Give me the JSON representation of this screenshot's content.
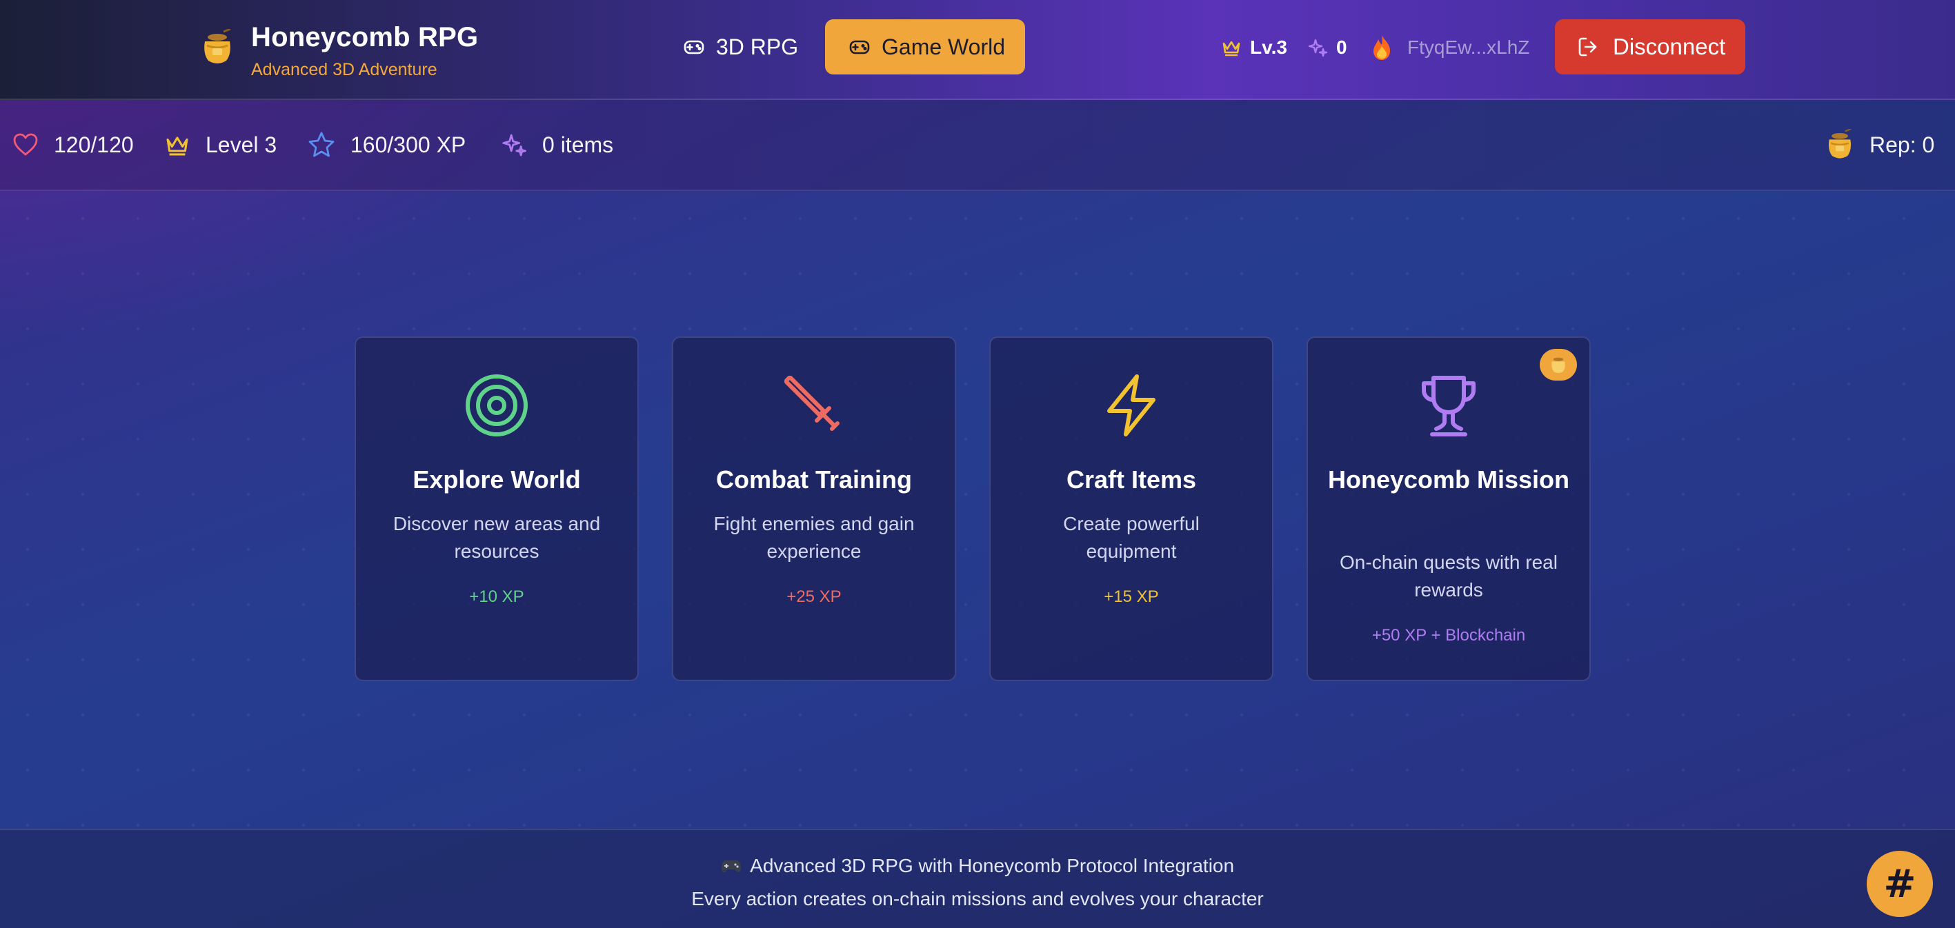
{
  "app": {
    "title": "Honeycomb RPG",
    "subtitle": "Advanced 3D Adventure",
    "logo_icon": "honey-pot-icon"
  },
  "nav": {
    "rpg_label": "3D RPG",
    "world_label": "Game World",
    "active": "Game World"
  },
  "hud": {
    "level": "Lv.3",
    "sparks": "0",
    "wallet": "FtyqEw...xLhZ",
    "disconnect_label": "Disconnect"
  },
  "stats": {
    "hp": "120/120",
    "level": "Level 3",
    "xp": "160/300 XP",
    "items": "0 items",
    "rep": "Rep: 0"
  },
  "cards": [
    {
      "icon": "target-icon",
      "title": "Explore World",
      "desc": "Discover new areas and resources",
      "reward": "+10 XP",
      "color": "#5fd38a"
    },
    {
      "icon": "sword-icon",
      "title": "Combat Training",
      "desc": "Fight enemies and gain experience",
      "reward": "+25 XP",
      "color": "#ef6b62"
    },
    {
      "icon": "lightning-icon",
      "title": "Craft Items",
      "desc": "Create powerful equipment",
      "reward": "+15 XP",
      "color": "#f2c230"
    },
    {
      "icon": "trophy-icon",
      "title": "Honeycomb Mission",
      "desc": "On-chain quests with real rewards",
      "reward": "+50 XP + Blockchain",
      "color": "#b07cf2"
    }
  ],
  "footer": {
    "line1": "Advanced 3D RPG with Honeycomb Protocol Integration",
    "line2": "Every action creates on-chain missions and evolves your character"
  },
  "fab_label": "#",
  "colors": {
    "accent": "#f0a63a",
    "danger": "#d63a2f"
  }
}
